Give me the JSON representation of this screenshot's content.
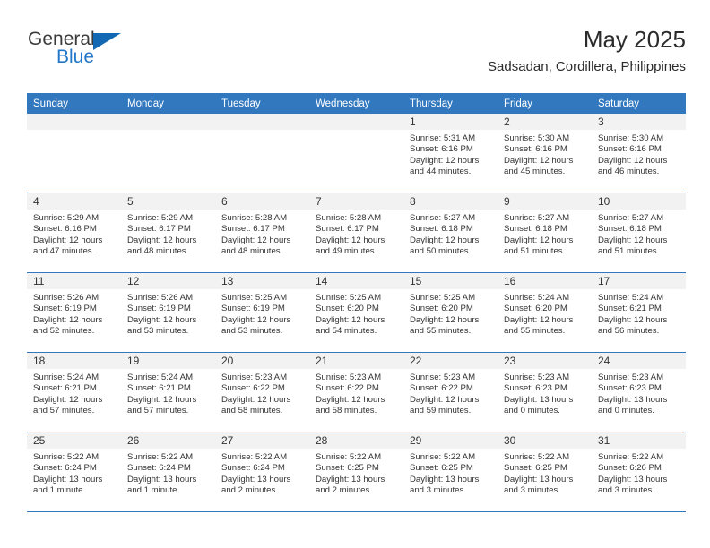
{
  "brand": {
    "name_top": "General",
    "name_bottom": "Blue",
    "triangle_icon": "blue-triangle-logo-mark",
    "color_top": "#3b3b3b",
    "color_bottom": "#2277c8"
  },
  "header": {
    "title": "May 2025",
    "subtitle": "Sadsadan, Cordillera, Philippines"
  },
  "theme": {
    "header_blue": "#3178bf",
    "daynum_band": "#f2f2f2",
    "text": "#333333"
  },
  "weekday_headers": [
    "Sunday",
    "Monday",
    "Tuesday",
    "Wednesday",
    "Thursday",
    "Friday",
    "Saturday"
  ],
  "weeks": [
    [
      {
        "day": "",
        "sunrise": "",
        "sunset": "",
        "daylight": ""
      },
      {
        "day": "",
        "sunrise": "",
        "sunset": "",
        "daylight": ""
      },
      {
        "day": "",
        "sunrise": "",
        "sunset": "",
        "daylight": ""
      },
      {
        "day": "",
        "sunrise": "",
        "sunset": "",
        "daylight": ""
      },
      {
        "day": "1",
        "sunrise": "Sunrise: 5:31 AM",
        "sunset": "Sunset: 6:16 PM",
        "daylight": "Daylight: 12 hours and 44 minutes."
      },
      {
        "day": "2",
        "sunrise": "Sunrise: 5:30 AM",
        "sunset": "Sunset: 6:16 PM",
        "daylight": "Daylight: 12 hours and 45 minutes."
      },
      {
        "day": "3",
        "sunrise": "Sunrise: 5:30 AM",
        "sunset": "Sunset: 6:16 PM",
        "daylight": "Daylight: 12 hours and 46 minutes."
      }
    ],
    [
      {
        "day": "4",
        "sunrise": "Sunrise: 5:29 AM",
        "sunset": "Sunset: 6:16 PM",
        "daylight": "Daylight: 12 hours and 47 minutes."
      },
      {
        "day": "5",
        "sunrise": "Sunrise: 5:29 AM",
        "sunset": "Sunset: 6:17 PM",
        "daylight": "Daylight: 12 hours and 48 minutes."
      },
      {
        "day": "6",
        "sunrise": "Sunrise: 5:28 AM",
        "sunset": "Sunset: 6:17 PM",
        "daylight": "Daylight: 12 hours and 48 minutes."
      },
      {
        "day": "7",
        "sunrise": "Sunrise: 5:28 AM",
        "sunset": "Sunset: 6:17 PM",
        "daylight": "Daylight: 12 hours and 49 minutes."
      },
      {
        "day": "8",
        "sunrise": "Sunrise: 5:27 AM",
        "sunset": "Sunset: 6:18 PM",
        "daylight": "Daylight: 12 hours and 50 minutes."
      },
      {
        "day": "9",
        "sunrise": "Sunrise: 5:27 AM",
        "sunset": "Sunset: 6:18 PM",
        "daylight": "Daylight: 12 hours and 51 minutes."
      },
      {
        "day": "10",
        "sunrise": "Sunrise: 5:27 AM",
        "sunset": "Sunset: 6:18 PM",
        "daylight": "Daylight: 12 hours and 51 minutes."
      }
    ],
    [
      {
        "day": "11",
        "sunrise": "Sunrise: 5:26 AM",
        "sunset": "Sunset: 6:19 PM",
        "daylight": "Daylight: 12 hours and 52 minutes."
      },
      {
        "day": "12",
        "sunrise": "Sunrise: 5:26 AM",
        "sunset": "Sunset: 6:19 PM",
        "daylight": "Daylight: 12 hours and 53 minutes."
      },
      {
        "day": "13",
        "sunrise": "Sunrise: 5:25 AM",
        "sunset": "Sunset: 6:19 PM",
        "daylight": "Daylight: 12 hours and 53 minutes."
      },
      {
        "day": "14",
        "sunrise": "Sunrise: 5:25 AM",
        "sunset": "Sunset: 6:20 PM",
        "daylight": "Daylight: 12 hours and 54 minutes."
      },
      {
        "day": "15",
        "sunrise": "Sunrise: 5:25 AM",
        "sunset": "Sunset: 6:20 PM",
        "daylight": "Daylight: 12 hours and 55 minutes."
      },
      {
        "day": "16",
        "sunrise": "Sunrise: 5:24 AM",
        "sunset": "Sunset: 6:20 PM",
        "daylight": "Daylight: 12 hours and 55 minutes."
      },
      {
        "day": "17",
        "sunrise": "Sunrise: 5:24 AM",
        "sunset": "Sunset: 6:21 PM",
        "daylight": "Daylight: 12 hours and 56 minutes."
      }
    ],
    [
      {
        "day": "18",
        "sunrise": "Sunrise: 5:24 AM",
        "sunset": "Sunset: 6:21 PM",
        "daylight": "Daylight: 12 hours and 57 minutes."
      },
      {
        "day": "19",
        "sunrise": "Sunrise: 5:24 AM",
        "sunset": "Sunset: 6:21 PM",
        "daylight": "Daylight: 12 hours and 57 minutes."
      },
      {
        "day": "20",
        "sunrise": "Sunrise: 5:23 AM",
        "sunset": "Sunset: 6:22 PM",
        "daylight": "Daylight: 12 hours and 58 minutes."
      },
      {
        "day": "21",
        "sunrise": "Sunrise: 5:23 AM",
        "sunset": "Sunset: 6:22 PM",
        "daylight": "Daylight: 12 hours and 58 minutes."
      },
      {
        "day": "22",
        "sunrise": "Sunrise: 5:23 AM",
        "sunset": "Sunset: 6:22 PM",
        "daylight": "Daylight: 12 hours and 59 minutes."
      },
      {
        "day": "23",
        "sunrise": "Sunrise: 5:23 AM",
        "sunset": "Sunset: 6:23 PM",
        "daylight": "Daylight: 13 hours and 0 minutes."
      },
      {
        "day": "24",
        "sunrise": "Sunrise: 5:23 AM",
        "sunset": "Sunset: 6:23 PM",
        "daylight": "Daylight: 13 hours and 0 minutes."
      }
    ],
    [
      {
        "day": "25",
        "sunrise": "Sunrise: 5:22 AM",
        "sunset": "Sunset: 6:24 PM",
        "daylight": "Daylight: 13 hours and 1 minute."
      },
      {
        "day": "26",
        "sunrise": "Sunrise: 5:22 AM",
        "sunset": "Sunset: 6:24 PM",
        "daylight": "Daylight: 13 hours and 1 minute."
      },
      {
        "day": "27",
        "sunrise": "Sunrise: 5:22 AM",
        "sunset": "Sunset: 6:24 PM",
        "daylight": "Daylight: 13 hours and 2 minutes."
      },
      {
        "day": "28",
        "sunrise": "Sunrise: 5:22 AM",
        "sunset": "Sunset: 6:25 PM",
        "daylight": "Daylight: 13 hours and 2 minutes."
      },
      {
        "day": "29",
        "sunrise": "Sunrise: 5:22 AM",
        "sunset": "Sunset: 6:25 PM",
        "daylight": "Daylight: 13 hours and 3 minutes."
      },
      {
        "day": "30",
        "sunrise": "Sunrise: 5:22 AM",
        "sunset": "Sunset: 6:25 PM",
        "daylight": "Daylight: 13 hours and 3 minutes."
      },
      {
        "day": "31",
        "sunrise": "Sunrise: 5:22 AM",
        "sunset": "Sunset: 6:26 PM",
        "daylight": "Daylight: 13 hours and 3 minutes."
      }
    ]
  ]
}
